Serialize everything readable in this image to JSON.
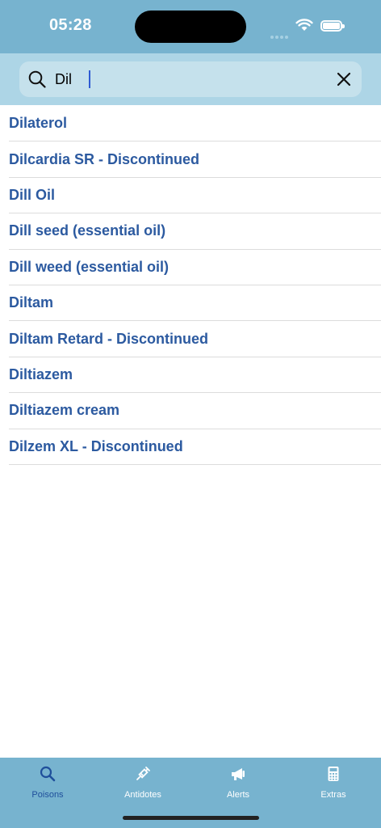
{
  "status": {
    "time": "05:28"
  },
  "search": {
    "query": "Dil",
    "placeholder": ""
  },
  "results": [
    "Dilaterol",
    "Dilcardia SR - Discontinued",
    "Dill Oil",
    "Dill seed (essential oil)",
    "Dill weed (essential oil)",
    "Diltam",
    "Diltam Retard - Discontinued",
    "Diltiazem",
    "Diltiazem cream",
    "Dilzem XL - Discontinued"
  ],
  "tabs": [
    {
      "label": "Poisons",
      "icon": "search-icon",
      "active": true
    },
    {
      "label": "Antidotes",
      "icon": "syringe-icon",
      "active": false
    },
    {
      "label": "Alerts",
      "icon": "megaphone-icon",
      "active": false
    },
    {
      "label": "Extras",
      "icon": "calculator-icon",
      "active": false
    }
  ],
  "colors": {
    "bar": "#77b3cf",
    "search_bg": "#add5e6",
    "link": "#2c5aa0",
    "active_tab": "#1f4f9b"
  }
}
